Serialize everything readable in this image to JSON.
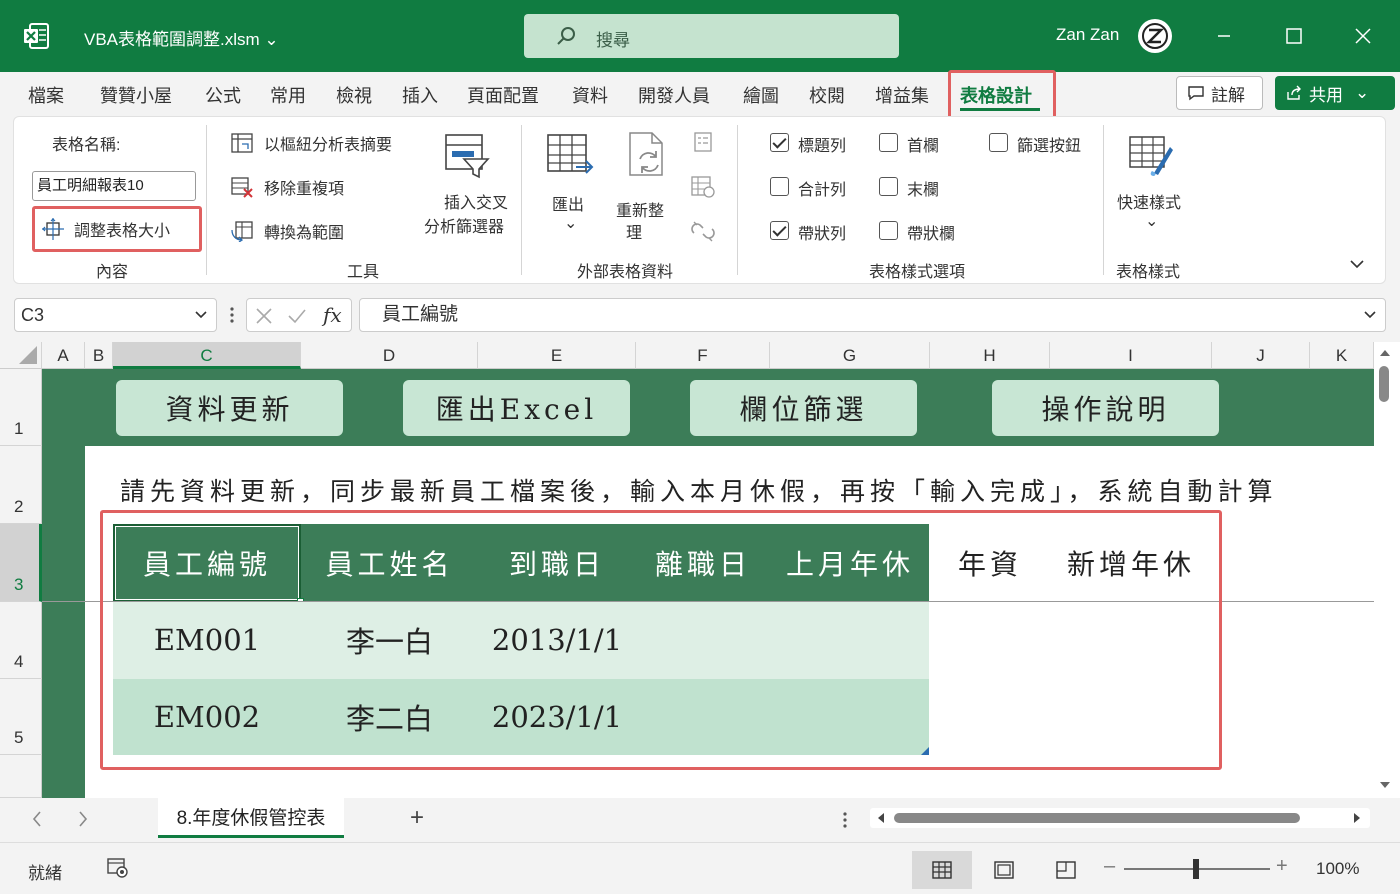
{
  "window": {
    "filename": "VBA表格範圍調整.xlsm",
    "search_placeholder": "搜尋",
    "user_name": "Zan Zan"
  },
  "tabs": [
    "檔案",
    "贊贊小屋",
    "公式",
    "常用",
    "檢視",
    "插入",
    "頁面配置",
    "資料",
    "開發人員",
    "繪圖",
    "校閱",
    "增益集",
    "表格設計"
  ],
  "active_tab": "表格設計",
  "header_buttons": {
    "comment": "註解",
    "share": "共用"
  },
  "ribbon": {
    "properties": {
      "table_name_label": "表格名稱:",
      "table_name_value": "員工明細報表10",
      "resize_table": "調整表格大小",
      "group_label": "內容"
    },
    "tools": {
      "summarize_pivot": "以樞紐分析表摘要",
      "remove_duplicates": "移除重複項",
      "convert_to_range": "轉換為範圍",
      "insert_slicer_line1": "插入交叉",
      "insert_slicer_line2": "分析篩選器",
      "group_label": "工具"
    },
    "external": {
      "export": "匯出",
      "refresh_line1": "重新整",
      "refresh_line2": "理",
      "group_label": "外部表格資料"
    },
    "style_options": {
      "header_row": {
        "label": "標題列",
        "checked": true
      },
      "total_row": {
        "label": "合計列",
        "checked": false
      },
      "banded_rows": {
        "label": "帶狀列",
        "checked": true
      },
      "first_column": {
        "label": "首欄",
        "checked": false
      },
      "last_column": {
        "label": "末欄",
        "checked": false
      },
      "banded_columns": {
        "label": "帶狀欄",
        "checked": false
      },
      "filter_button": {
        "label": "篩選按鈕",
        "checked": false
      },
      "group_label": "表格樣式選項"
    },
    "styles": {
      "quick_styles": "快速樣式",
      "group_label": "表格樣式"
    }
  },
  "formula_bar": {
    "name_box": "C3",
    "fx": "fx",
    "formula": "員工編號"
  },
  "grid": {
    "columns": [
      "A",
      "B",
      "C",
      "D",
      "E",
      "F",
      "G",
      "H",
      "I",
      "J",
      "K"
    ],
    "rows": [
      "1",
      "2",
      "3",
      "4",
      "5"
    ],
    "macro_buttons": [
      "資料更新",
      "匯出Excel",
      "欄位篩選",
      "操作說明"
    ],
    "instruction": "請先資料更新，同步最新員工檔案後，輸入本月休假，再按「輸入完成」，系統自動計算",
    "table_headers": [
      "員工編號",
      "員工姓名",
      "到職日",
      "離職日",
      "上月年休"
    ],
    "extra_headers": [
      "年資",
      "新增年休"
    ],
    "table_rows": [
      {
        "id": "EM001",
        "name": "李一白",
        "start": "2013/1/1"
      },
      {
        "id": "EM002",
        "name": "李二白",
        "start": "2023/1/1"
      }
    ]
  },
  "sheet": {
    "active_sheet": "8.年度休假管控表",
    "add": "+"
  },
  "status": {
    "ready": "就緒",
    "zoom": "100%"
  },
  "colors": {
    "brand": "#107c41",
    "table_header": "#3c7d58",
    "band_light": "#deefe5",
    "band_dark": "#c0e2cf",
    "highlight": "#e06060"
  }
}
